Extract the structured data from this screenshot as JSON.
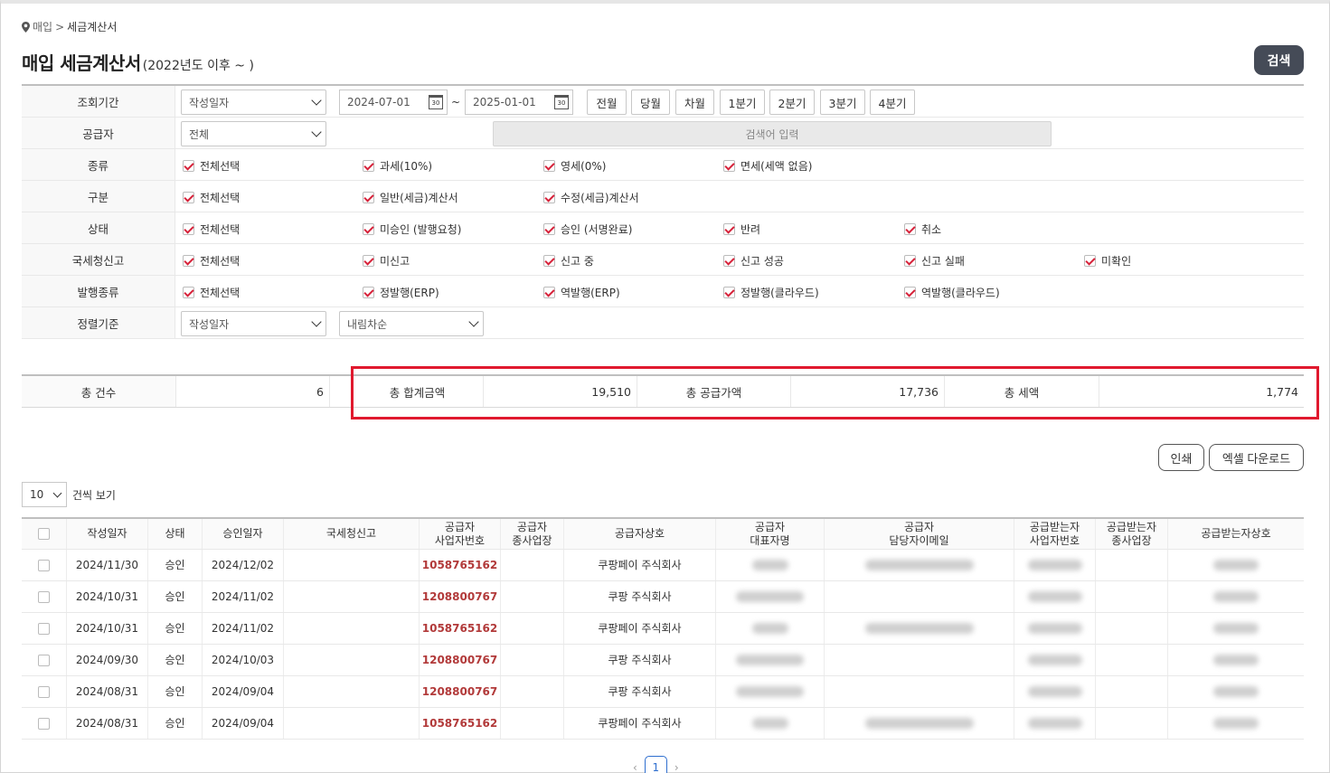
{
  "breadcrumb": {
    "parent": "매입",
    "separator": ">",
    "current": "세금계산서"
  },
  "page": {
    "title": "매입 세금계산서",
    "subtitle": "(2022년도 이후 ~ )",
    "search_label": "검색"
  },
  "filters": {
    "period": {
      "label": "조회기간",
      "type_value": "작성일자",
      "start": "2024-07-01",
      "tilde": "~",
      "end": "2025-01-01",
      "cal_glyph": "30",
      "buttons": [
        "전월",
        "당월",
        "차월",
        "1분기",
        "2분기",
        "3분기",
        "4분기"
      ]
    },
    "supplier": {
      "label": "공급자",
      "value": "전체",
      "placeholder": "검색어 입력"
    },
    "kind": {
      "label": "종류",
      "options": [
        "전체선택",
        "과세(10%)",
        "영세(0%)",
        "면세(세액 없음)"
      ]
    },
    "division": {
      "label": "구분",
      "options": [
        "전체선택",
        "일반(세금)계산서",
        "수정(세금)계산서"
      ]
    },
    "status": {
      "label": "상태",
      "options": [
        "전체선택",
        "미승인 (발행요청)",
        "승인 (서명완료)",
        "반려",
        "취소"
      ]
    },
    "nts": {
      "label": "국세청신고",
      "options": [
        "전체선택",
        "미신고",
        "신고 중",
        "신고 성공",
        "신고 실패",
        "미확인"
      ]
    },
    "issue_type": {
      "label": "발행종류",
      "options": [
        "전체선택",
        "정발행(ERP)",
        "역발행(ERP)",
        "정발행(클라우드)",
        "역발행(클라우드)"
      ]
    },
    "sort": {
      "label": "정렬기준",
      "field": "작성일자",
      "order": "내림차순"
    }
  },
  "summary": {
    "count_label": "총 건수",
    "count": "6",
    "total_label": "총 합계금액",
    "total": "19,510",
    "supply_label": "총 공급가액",
    "supply": "17,736",
    "tax_label": "총 세액",
    "tax": "1,774"
  },
  "actions": {
    "print": "인쇄",
    "excel": "엑셀 다운로드"
  },
  "per_page": {
    "value": "10",
    "label": "건씩 보기"
  },
  "table": {
    "headers": [
      "작성일자",
      "상태",
      "승인일자",
      "국세청신고",
      "공급자\n사업자번호",
      "공급자\n종사업장",
      "공급자상호",
      "공급자\n대표자명",
      "공급자\n담당자이메일",
      "공급받는자\n사업자번호",
      "공급받는자\n종사업장",
      "공급받는자상호"
    ],
    "rows": [
      {
        "date": "2024/11/30",
        "status": "승인",
        "approved": "2024/12/02",
        "biz_no": "1058765162",
        "company": "쿠팡페이 주식회사"
      },
      {
        "date": "2024/10/31",
        "status": "승인",
        "approved": "2024/11/02",
        "biz_no": "1208800767",
        "company": "쿠팡 주식회사"
      },
      {
        "date": "2024/10/31",
        "status": "승인",
        "approved": "2024/11/02",
        "biz_no": "1058765162",
        "company": "쿠팡페이 주식회사"
      },
      {
        "date": "2024/09/30",
        "status": "승인",
        "approved": "2024/10/03",
        "biz_no": "1208800767",
        "company": "쿠팡 주식회사"
      },
      {
        "date": "2024/08/31",
        "status": "승인",
        "approved": "2024/09/04",
        "biz_no": "1208800767",
        "company": "쿠팡 주식회사"
      },
      {
        "date": "2024/08/31",
        "status": "승인",
        "approved": "2024/09/04",
        "biz_no": "1058765162",
        "company": "쿠팡페이 주식회사"
      }
    ]
  },
  "pagination": {
    "prev": "‹",
    "current": "1",
    "next": "›"
  },
  "colors": {
    "accent_check": "#d6223a",
    "highlight_border": "#e0192e",
    "biz_number": "#b23a3a",
    "search_button": "#454b57"
  }
}
